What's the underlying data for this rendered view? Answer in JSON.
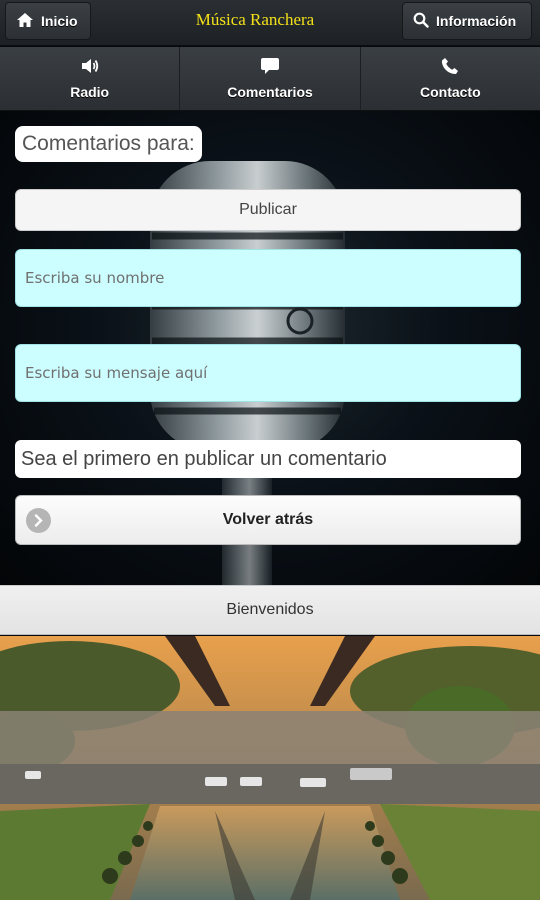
{
  "header": {
    "home_label": "Inicio",
    "title": "Música Ranchera",
    "info_label": "Información"
  },
  "nav": [
    {
      "label": "Radio",
      "icon": "speaker-icon"
    },
    {
      "label": "Comentarios",
      "icon": "comment-icon"
    },
    {
      "label": "Contacto",
      "icon": "phone-icon"
    }
  ],
  "content": {
    "comments_for_label": "Comentarios para:",
    "publish_label": "Publicar",
    "name_placeholder": "Escriba su nombre",
    "message_placeholder": "Escriba su mensaje aquí",
    "empty_notice": "Sea el primero en publicar un comentario",
    "back_label": "Volver atrás"
  },
  "footer": {
    "welcome": "Bienvenidos"
  },
  "colors": {
    "title_yellow": "#f4e01a",
    "input_bg": "#ccfeff",
    "header_bg": "#2a2f33"
  }
}
